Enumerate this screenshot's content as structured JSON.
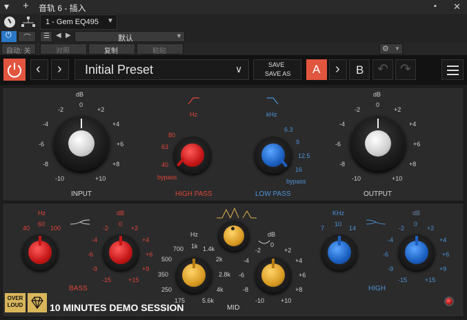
{
  "titlebar": {
    "title": "音轨 6 - 插入",
    "plus_icon": "plus-icon",
    "pin_icon": "pin-icon",
    "menu_icon": "menu-icon",
    "close_icon": "close-icon"
  },
  "host": {
    "track_selector": "1 - Gem EQ495",
    "preset_name": "默认",
    "auto_label": "自动: 关",
    "compare_label": "对照",
    "copy_label": "复制",
    "paste_label": "粘贴"
  },
  "toolbar": {
    "preset_name": "Initial Preset",
    "save_label": "SAVE",
    "save_as_label": "SAVE AS",
    "a_label": "A",
    "b_label": "B",
    "accent": "#e2553f"
  },
  "top_panel": {
    "input": {
      "label": "INPUT",
      "unit": "dB",
      "ticks": [
        "-2",
        "0",
        "+2",
        "-4",
        "+4",
        "-6",
        "+6",
        "-8",
        "+8",
        "-10",
        "+10"
      ]
    },
    "high_pass": {
      "label": "HIGH PASS",
      "unit": "Hz",
      "ticks": [
        "80",
        "63",
        "40",
        "bypass"
      ]
    },
    "low_pass": {
      "label": "LOW PASS",
      "unit": "kHz",
      "ticks": [
        "6.3",
        "9",
        "12.5",
        "16",
        "bypass"
      ]
    },
    "output": {
      "label": "OUTPUT",
      "unit": "dB",
      "ticks": [
        "-2",
        "0",
        "+2",
        "-4",
        "+4",
        "-6",
        "+6",
        "-8",
        "+8",
        "-10",
        "+10"
      ]
    }
  },
  "bottom_panel": {
    "bass": {
      "label": "BASS",
      "freq_unit": "Hz",
      "freq_ticks": [
        "40",
        "60",
        "100"
      ],
      "gain_unit": "dB",
      "gain_ticks": [
        "-2",
        "0",
        "+2",
        "-4",
        "+4",
        "-6",
        "+6",
        "-9",
        "+9",
        "-15",
        "+15"
      ]
    },
    "mid": {
      "label": "MID",
      "freq_unit": "Hz",
      "freq_ticks": [
        "1k",
        "700",
        "1.4k",
        "500",
        "2k",
        "350",
        "2.8k",
        "250",
        "4k",
        "175",
        "5.6k"
      ],
      "gain_unit": "dB",
      "gain_ticks": [
        "-2",
        "0",
        "+2",
        "-4",
        "+4",
        "-6",
        "+6",
        "-8",
        "+8",
        "-10",
        "+10"
      ]
    },
    "high": {
      "label": "HIGH",
      "freq_unit": "KHz",
      "freq_ticks": [
        "7",
        "10",
        "14"
      ],
      "gain_unit": "dB",
      "gain_ticks": [
        "-2",
        "0",
        "+2",
        "-4",
        "+4",
        "-6",
        "+6",
        "-9",
        "+9",
        "-15",
        "+15"
      ]
    },
    "logo_text": "OVER LOUD",
    "demo_text": "10 MINUTES DEMO SESSION"
  }
}
